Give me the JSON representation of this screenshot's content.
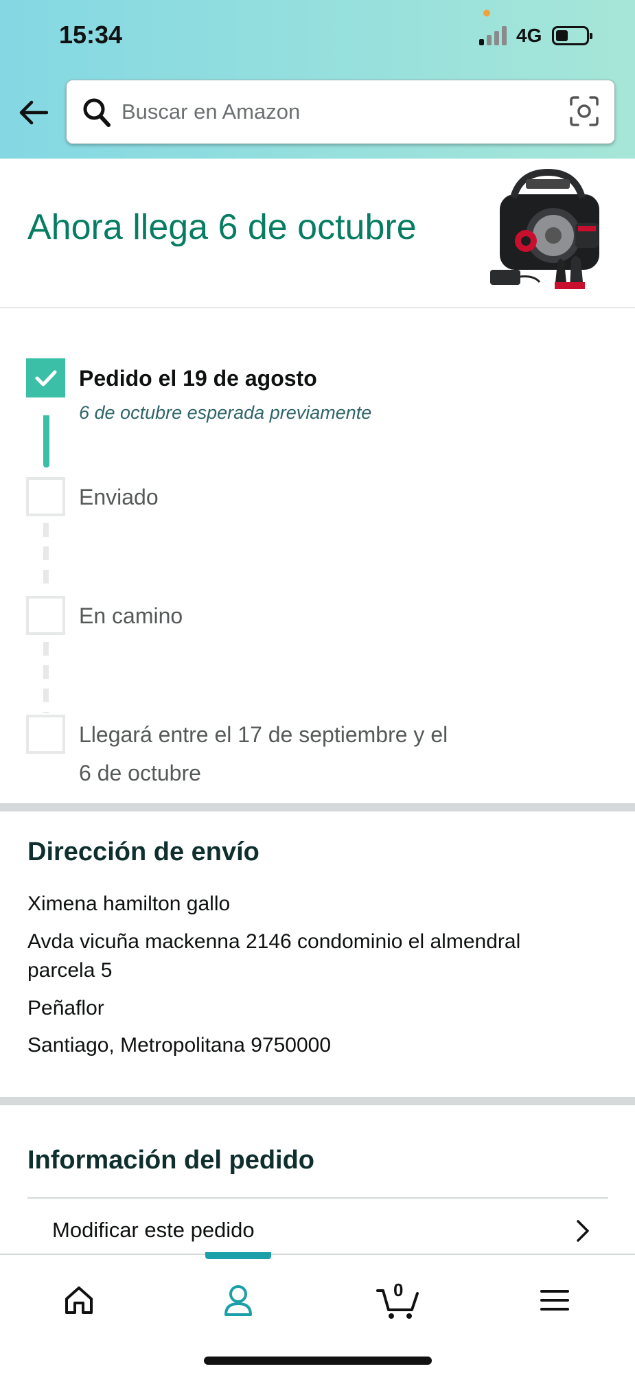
{
  "status_bar": {
    "time": "15:34",
    "network": "4G"
  },
  "search": {
    "placeholder": "Buscar en Amazon"
  },
  "arrival": {
    "title": "Ahora llega 6 de octubre"
  },
  "timeline": {
    "steps": [
      {
        "label": "Pedido el 19 de agosto",
        "sub": "6 de octubre esperada previamente",
        "done": true
      },
      {
        "label": "Enviado",
        "done": false
      },
      {
        "label": "En camino",
        "done": false
      },
      {
        "label": "Llegará entre el 17 de septiembre y el",
        "label2": "6 de octubre",
        "done": false
      }
    ]
  },
  "address": {
    "title": "Dirección de envío",
    "lines": [
      "Ximena hamilton gallo",
      "Avda vicuña mackenna 2146 condominio el almendral",
      "parcela 5",
      "Peñaflor",
      "Santiago, Metropolitana 9750000"
    ]
  },
  "order_info": {
    "title": "Información del pedido",
    "rows": [
      {
        "label": "Modificar este pedido"
      }
    ]
  },
  "bottom_nav": {
    "items": [
      "home-icon",
      "account-icon",
      "cart-icon",
      "menu-icon"
    ],
    "active": "account-icon",
    "cart_count": "0"
  },
  "colors": {
    "accent": "#067d62",
    "check": "#3bbfa7",
    "nav_active": "#1b9fa8"
  }
}
